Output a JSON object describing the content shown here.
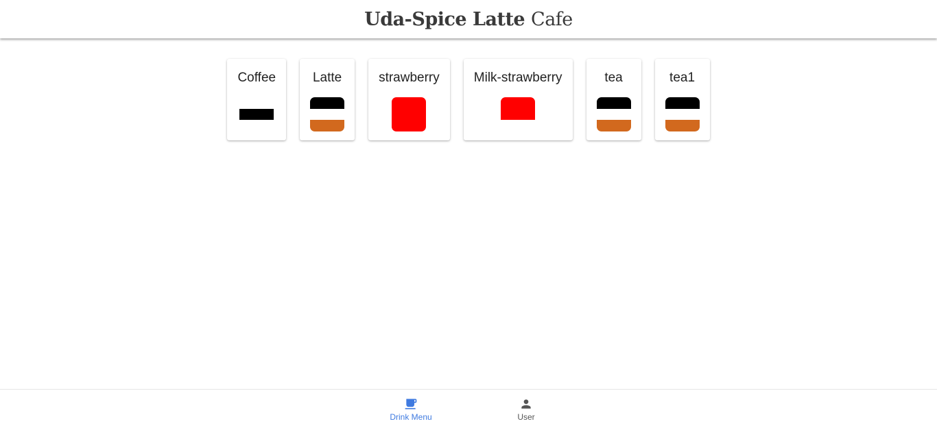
{
  "header": {
    "title_bold": "Uda-Spice Latte",
    "title_light": "Cafe"
  },
  "drinks": [
    {
      "name": "Coffee",
      "layers": [
        {
          "color": "#000000",
          "start": 0.34,
          "end": 0.66
        }
      ],
      "rounded": false
    },
    {
      "name": "Latte",
      "layers": [
        {
          "color": "#000000",
          "start": 0.0,
          "end": 0.34
        },
        {
          "color": "#d2691e",
          "start": 0.66,
          "end": 1.0
        }
      ],
      "rounded": true
    },
    {
      "name": "strawberry",
      "layers": [
        {
          "color": "#ff0000",
          "start": 0.0,
          "end": 1.0
        }
      ],
      "rounded": true
    },
    {
      "name": "Milk-strawberry",
      "layers": [
        {
          "color": "#ff0000",
          "start": 0.0,
          "end": 0.66
        }
      ],
      "rounded": true
    },
    {
      "name": "tea",
      "layers": [
        {
          "color": "#000000",
          "start": 0.0,
          "end": 0.34
        },
        {
          "color": "#d2691e",
          "start": 0.66,
          "end": 1.0
        }
      ],
      "rounded": true
    },
    {
      "name": "tea1",
      "layers": [
        {
          "color": "#000000",
          "start": 0.0,
          "end": 0.34
        },
        {
          "color": "#d2691e",
          "start": 0.66,
          "end": 1.0
        }
      ],
      "rounded": true
    }
  ],
  "bottom_nav": {
    "drink_menu": {
      "label": "Drink Menu",
      "icon": "coffee-cup-icon",
      "active": true
    },
    "user": {
      "label": "User",
      "icon": "person-icon",
      "active": false
    }
  },
  "colors": {
    "accent": "#3f7ae0",
    "inactive": "#555555"
  }
}
